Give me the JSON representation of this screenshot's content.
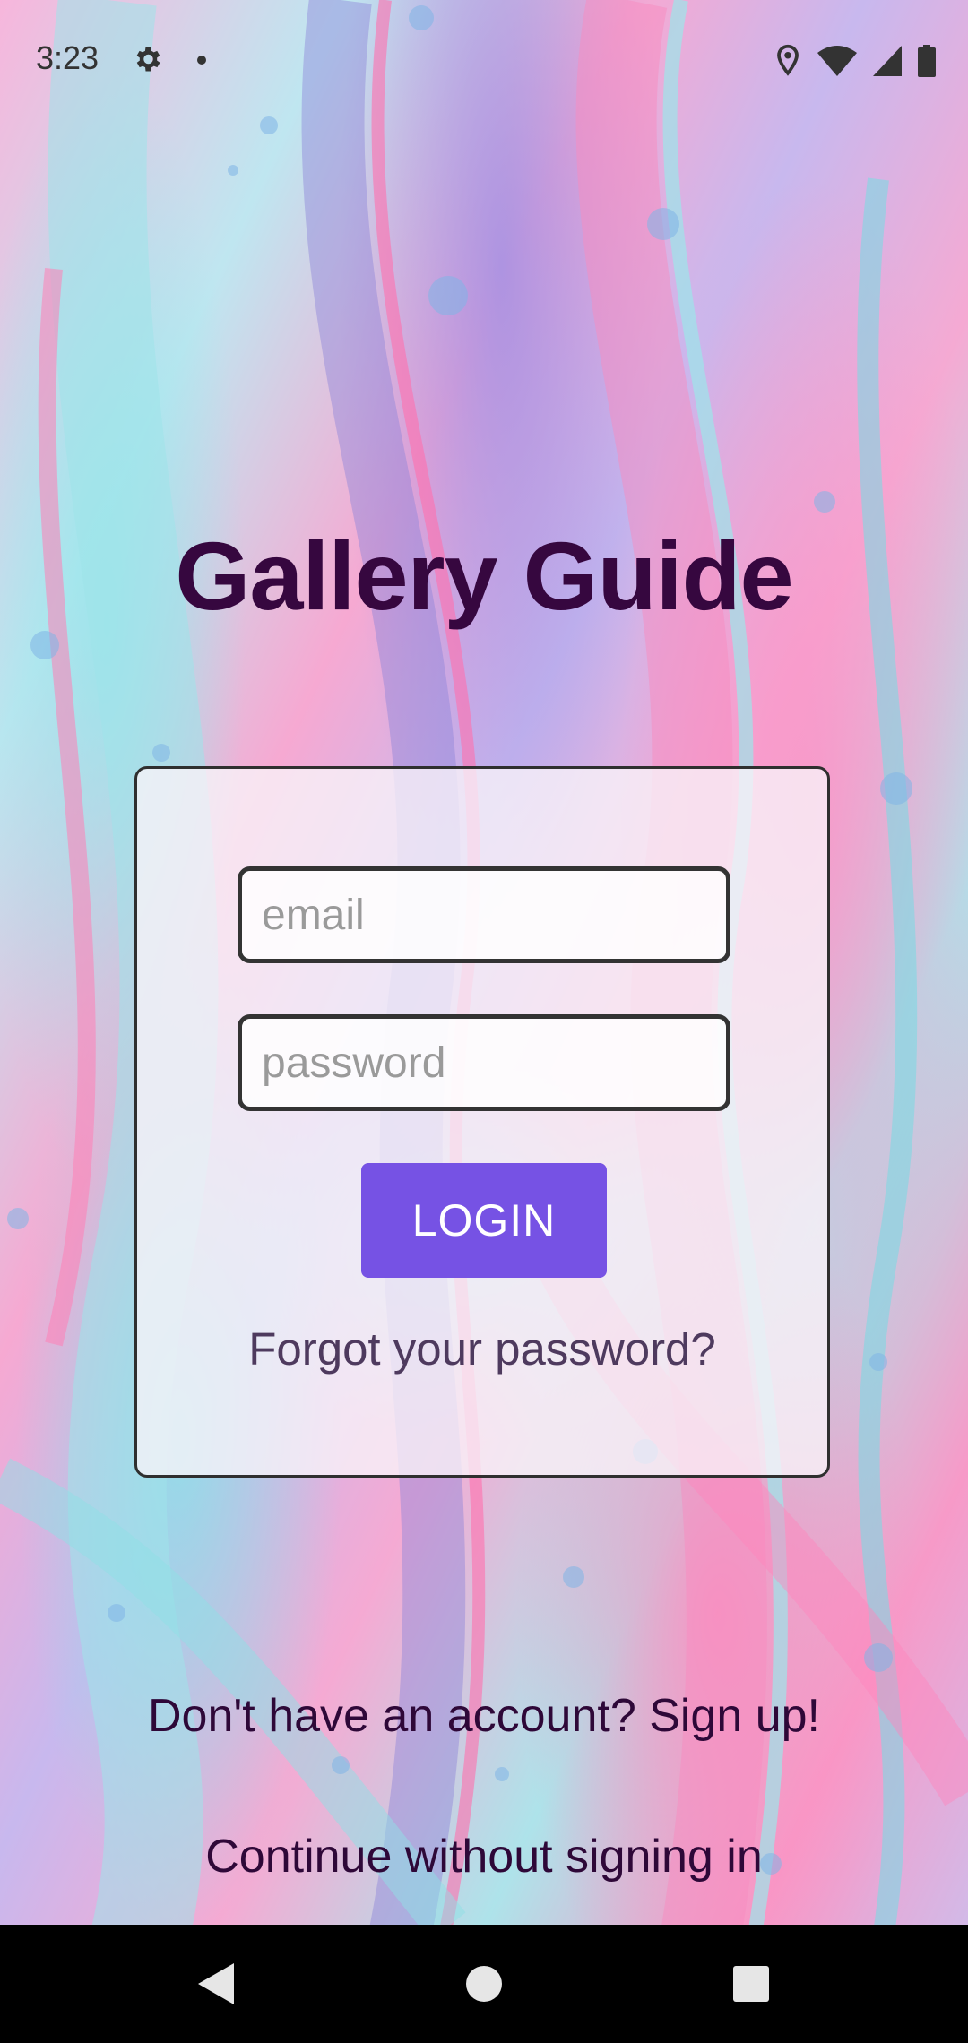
{
  "status_bar": {
    "time": "3:23",
    "left_icons": [
      "gear-icon",
      "notification-dot"
    ],
    "right_icons": [
      "location-icon",
      "wifi-icon",
      "signal-icon",
      "battery-icon"
    ]
  },
  "app": {
    "title": "Gallery Guide"
  },
  "login_form": {
    "email_placeholder": "email",
    "email_value": "",
    "password_placeholder": "password",
    "password_value": "",
    "login_label": "LOGIN",
    "forgot_label": "Forgot your password?"
  },
  "footer": {
    "signup_label": "Don't have an account? Sign up!",
    "guest_label": "Continue without signing in"
  },
  "nav_bar": {
    "buttons": [
      "back-icon",
      "home-icon",
      "recents-icon"
    ]
  },
  "colors": {
    "title": "#36073f",
    "login_button": "#7652e4",
    "link_text": "#2e0838",
    "forgot_text": "#4e3a5e",
    "nav_background": "#000000"
  }
}
